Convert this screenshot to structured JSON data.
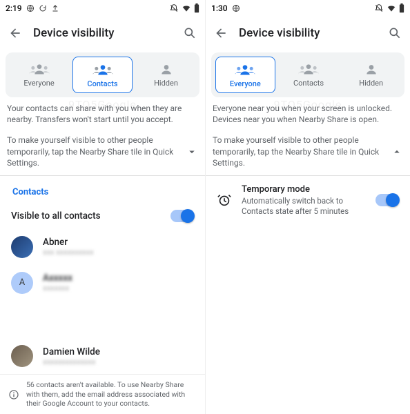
{
  "left": {
    "status": {
      "time": "2:19"
    },
    "title": "Device visibility",
    "watermark": "9TO5Google",
    "segments": {
      "everyone": "Everyone",
      "contacts": "Contacts",
      "hidden": "Hidden",
      "active": "contacts"
    },
    "desc1": "Your contacts can share with you when they are nearby. Transfers won't start until you accept.",
    "desc2": "To make yourself visible to other people temporarily, tap the Nearby Share tile in Quick Settings.",
    "section_label": "Contacts",
    "visible_all": "Visible to all contacts",
    "contacts": [
      {
        "name": "Abner",
        "sub": "xxx xxxxxxxxxx",
        "avatar_bg": "#1d3b6f"
      },
      {
        "name": "Axxxxx",
        "sub": "xxxxxxx",
        "avatar_bg": "#aecbfa",
        "letter": "A",
        "blur_name": true
      },
      {
        "name": "Damien Wilde",
        "sub": "xxxxxxxxxxxxxx",
        "avatar_bg": "#6b5e4f"
      }
    ],
    "footer": "56 contacts aren't available. To use Nearby Share with them, add the email address associated with their Google Account to your contacts."
  },
  "right": {
    "status": {
      "time": "1:30"
    },
    "title": "Device visibility",
    "watermark": "9TO5Google",
    "segments": {
      "everyone": "Everyone",
      "contacts": "Contacts",
      "hidden": "Hidden",
      "active": "everyone"
    },
    "desc1": "Everyone near you when your screen is unlocked. Devices near you when Nearby Share is open.",
    "desc2": "To make yourself visible to other people temporarily, tap the Nearby Share tile in Quick Settings.",
    "temp": {
      "title": "Temporary mode",
      "sub": "Automatically switch back to Contacts state after 5 minutes"
    }
  }
}
